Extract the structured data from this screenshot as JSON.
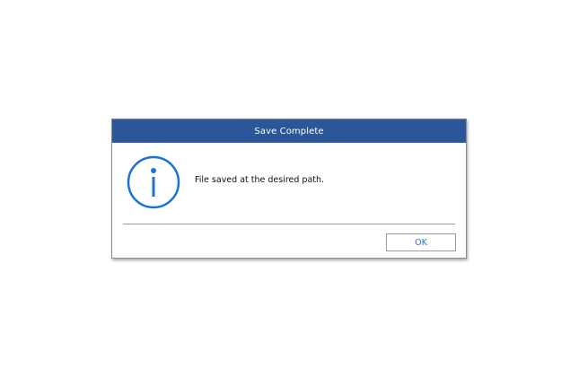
{
  "dialog": {
    "title": "Save Complete",
    "message": "File saved at the desired path.",
    "ok_label": "OK",
    "icon": "info-icon"
  },
  "colors": {
    "titlebar": "#2b579a",
    "icon": "#1a73d9",
    "ok_text": "#2b6fd6"
  }
}
